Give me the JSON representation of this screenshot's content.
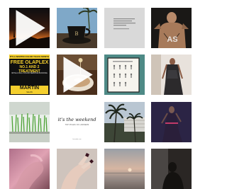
{
  "feed": {
    "tiles": [
      {
        "kind": "video",
        "scene": "dark-sunset-silhouette"
      },
      {
        "kind": "photo",
        "scene": "coffee-cup-palm-tree",
        "cup_logo": "B"
      },
      {
        "kind": "photo",
        "scene": "grey-quote-card"
      },
      {
        "kind": "photo",
        "scene": "shirtless-man-portrait"
      },
      {
        "kind": "promo",
        "strip": "IT'S A MARTIN COLOR TEACH MONTH",
        "headline": [
          "FREE OLAPLEX",
          "NO.1 AND 2 TREATMENT"
        ],
        "sub": "WITH A FULL COLOR SERVICE BOOKING",
        "brand": "MARTIN",
        "brand_sub": "SALON"
      },
      {
        "kind": "video",
        "scene": "latte-art-cup"
      },
      {
        "kind": "photo",
        "scene": "yoga-poster-frame"
      },
      {
        "kind": "photo",
        "scene": "woman-dress-portrait"
      },
      {
        "kind": "photo",
        "scene": "wheatgrass-tray"
      },
      {
        "kind": "quote",
        "main": "it's the weekend",
        "tag": "TOP POLES OF LAWNERS",
        "by": "bonzobo.com"
      },
      {
        "kind": "photo",
        "scene": "palm-trees-buildings"
      },
      {
        "kind": "photo",
        "scene": "dark-dancer-portrait"
      },
      {
        "kind": "photo",
        "scene": "hands-pink-blur"
      },
      {
        "kind": "photo",
        "scene": "hand-dark-nails"
      },
      {
        "kind": "photo",
        "scene": "beach-dusk"
      },
      {
        "kind": "photo",
        "scene": "silhouette-dark-room"
      }
    ]
  },
  "colors": {
    "background": "#ffffff",
    "promo_yellow": "#f4cf2e",
    "card_grey": "#d9d9d9"
  }
}
